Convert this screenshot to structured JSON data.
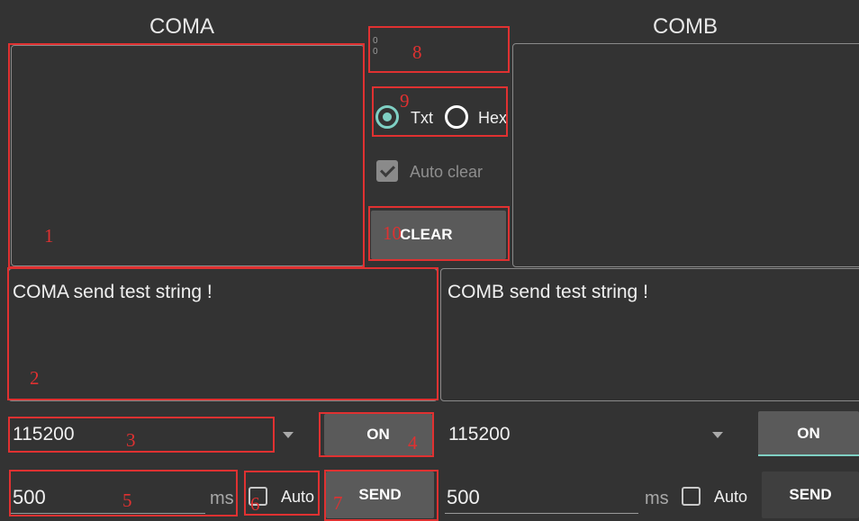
{
  "coma": {
    "title": "COMA",
    "send_text": "COMA send test string !",
    "baud": "115200",
    "on_label": "ON",
    "interval_value": "500",
    "ms_label": "ms",
    "auto_label": "Auto",
    "send_label": "SEND"
  },
  "comb": {
    "title": "COMB",
    "send_text": "COMB send test string !",
    "baud": "115200",
    "on_label": "ON",
    "interval_value": "500",
    "ms_label": "ms",
    "auto_label": "Auto",
    "send_label": "SEND"
  },
  "middle": {
    "counter_top": "0",
    "counter_bottom": "0",
    "radio_txt": "Txt",
    "radio_hex": "Hex",
    "auto_clear_label": "Auto clear",
    "clear_label": "CLEAR"
  },
  "annotations": [
    "1",
    "2",
    "3",
    "4",
    "5",
    "6",
    "7",
    "8",
    "9",
    "10"
  ],
  "colors": {
    "background": "#333333",
    "annotation_red": "#e03131",
    "radio_accent": "#7fd0c4",
    "button_gray": "#5a5a5a"
  }
}
